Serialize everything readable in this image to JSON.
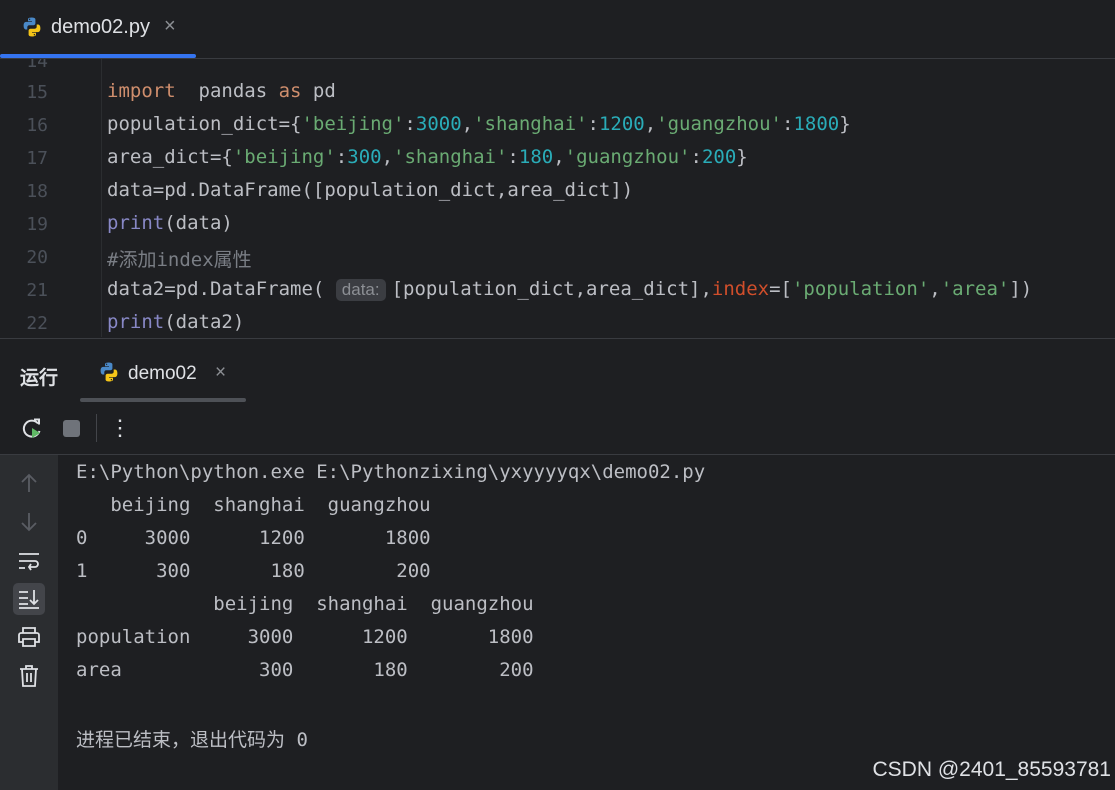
{
  "editor_tab": {
    "filename": "demo02.py",
    "close": "×"
  },
  "editor": {
    "partial_line_number": "14",
    "line_numbers": [
      "15",
      "16",
      "17",
      "18",
      "19",
      "20",
      "21",
      "22"
    ],
    "inlay_hint": "data:"
  },
  "run_panel": {
    "title": "运行",
    "tab_name": "demo02",
    "close": "×",
    "more": "⋮"
  },
  "console": {
    "lines": [
      "E:\\Python\\python.exe E:\\Pythonzixing\\yxyyyyqx\\demo02.py",
      "   beijing  shanghai  guangzhou",
      "0     3000      1200       1800",
      "1      300       180        200",
      "            beijing  shanghai  guangzhou",
      "population     3000      1200       1800",
      "area            300       180        200",
      "",
      "进程已结束，退出代码为 0"
    ]
  },
  "watermark": "CSDN @2401_85593781",
  "colors": {
    "accent": "#3574f0",
    "keyword": "#cf8e6d",
    "string": "#6aab73",
    "number": "#2aacb8"
  }
}
